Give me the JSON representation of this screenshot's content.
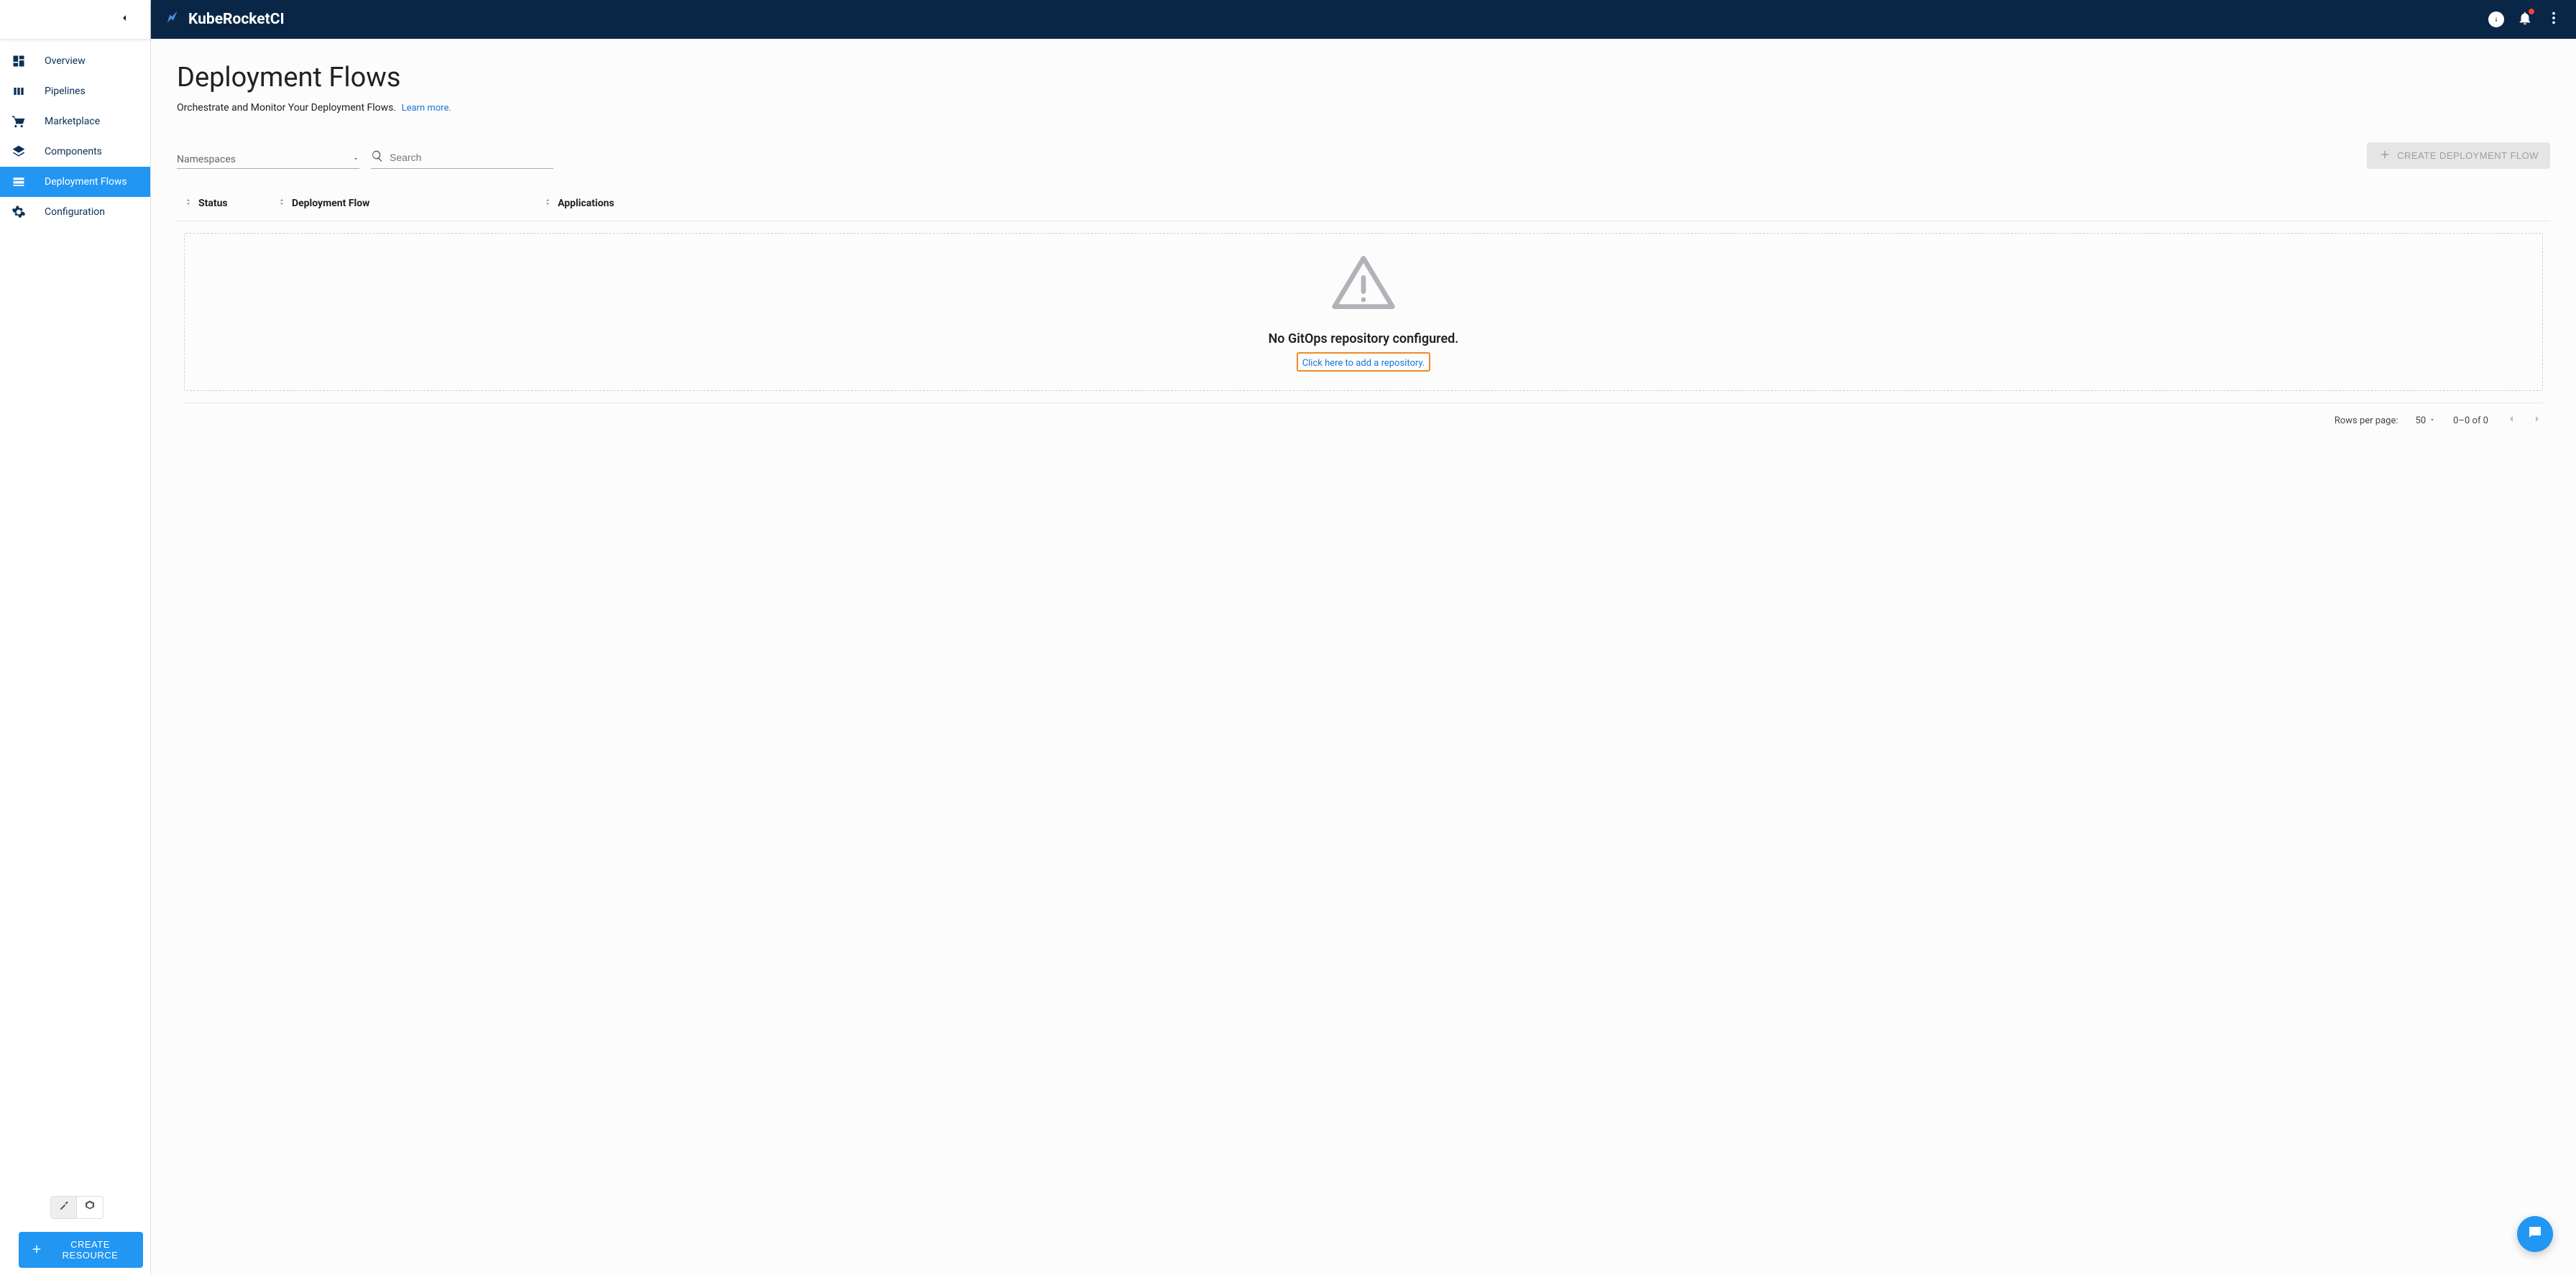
{
  "brand": {
    "name": "KubeRocketCI"
  },
  "sidebar": {
    "items": [
      {
        "label": "Overview"
      },
      {
        "label": "Pipelines"
      },
      {
        "label": "Marketplace"
      },
      {
        "label": "Components"
      },
      {
        "label": "Deployment Flows"
      },
      {
        "label": "Configuration"
      }
    ],
    "create_resource_label": "CREATE RESOURCE"
  },
  "page": {
    "title": "Deployment Flows",
    "subtitle": "Orchestrate and Monitor Your Deployment Flows.",
    "learn_more": "Learn more."
  },
  "filters": {
    "namespaces_label": "Namespaces",
    "search_placeholder": "Search",
    "create_flow_label": "CREATE DEPLOYMENT FLOW"
  },
  "table": {
    "columns": {
      "status": "Status",
      "flow": "Deployment Flow",
      "apps": "Applications"
    },
    "empty": {
      "title": "No GitOps repository configured.",
      "link_text": "Click here to add a repository."
    }
  },
  "pagination": {
    "rows_label": "Rows per page:",
    "rows_value": "50",
    "range": "0–0 of 0"
  }
}
